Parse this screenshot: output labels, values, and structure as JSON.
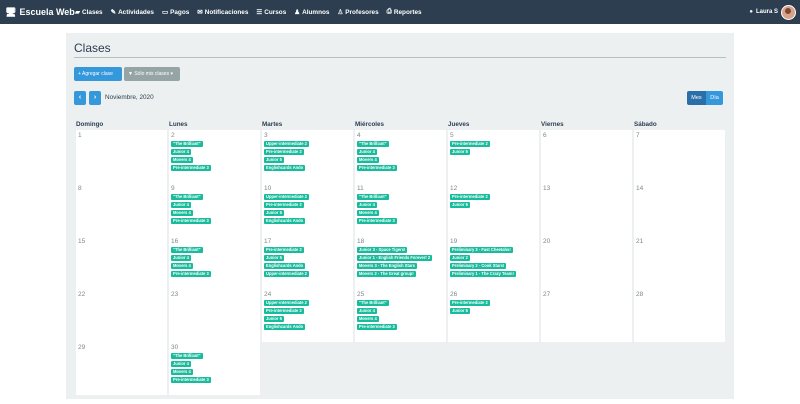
{
  "navbar": {
    "brand": "Escuela Web",
    "brand_icon": "monitor-icon",
    "items": [
      {
        "label": "Clases",
        "icon": "book-icon"
      },
      {
        "label": "Actividades",
        "icon": "pencil-icon"
      },
      {
        "label": "Pagos",
        "icon": "credit-card-icon"
      },
      {
        "label": "Notificaciones",
        "icon": "envelope-icon"
      },
      {
        "label": "Cursos",
        "icon": "list-icon"
      },
      {
        "label": "Alumnos",
        "icon": "student-icon"
      },
      {
        "label": "Profesores",
        "icon": "teacher-icon"
      },
      {
        "label": "Reportes",
        "icon": "print-icon"
      }
    ],
    "user": "Laura S"
  },
  "page": {
    "title": "Clases",
    "add_button": "+ Agregar clase",
    "filter_button": "Sólo mis clases",
    "prev": "‹",
    "next": "›",
    "month": "Noviembre, 2020",
    "view_month": "Mes",
    "view_day": "Día"
  },
  "calendar": {
    "weekdays": [
      "Domingo",
      "Lunes",
      "Martes",
      "Miércoles",
      "Jueves",
      "Viernes",
      "Sábado"
    ],
    "weeks": [
      [
        {
          "day": "1",
          "events": []
        },
        {
          "day": "2",
          "events": [
            "\"The Brilliant\"",
            "Junior 4",
            "Movers 4",
            "Pre-intermediate 3"
          ]
        },
        {
          "day": "3",
          "events": [
            "Upper-intermediate 2",
            "Pre-intermediate 2",
            "Junior 5",
            "Englishcards Ando"
          ]
        },
        {
          "day": "4",
          "events": [
            "\"The Brilliant\"",
            "Junior 4",
            "Movers 4",
            "Pre-intermediate 3"
          ]
        },
        {
          "day": "5",
          "events": [
            "Pre-intermediate 2",
            "Junior 5"
          ]
        },
        {
          "day": "6",
          "events": []
        },
        {
          "day": "7",
          "events": []
        }
      ],
      [
        {
          "day": "8",
          "events": []
        },
        {
          "day": "9",
          "events": [
            "\"The Brilliant\"",
            "Junior 4",
            "Movers 4",
            "Pre-intermediate 3"
          ]
        },
        {
          "day": "10",
          "events": [
            "Upper-intermediate 2",
            "Pre-intermediate 2",
            "Junior 5",
            "Englishcards Ando"
          ]
        },
        {
          "day": "11",
          "events": [
            "\"The Brilliant\"",
            "Junior 4",
            "Movers 4",
            "Pre-intermediate 3"
          ]
        },
        {
          "day": "12",
          "events": [
            "Pre-intermediate 2",
            "Junior 5"
          ]
        },
        {
          "day": "13",
          "events": []
        },
        {
          "day": "14",
          "events": []
        }
      ],
      [
        {
          "day": "15",
          "events": []
        },
        {
          "day": "16",
          "events": [
            "\"The Brilliant\"",
            "Junior 4",
            "Movers 4",
            "Pre-intermediate 3"
          ]
        },
        {
          "day": "17",
          "events": [
            "Pre-intermediate 2",
            "Junior 5",
            "Englishcards Ando",
            "Upper-intermediate 2"
          ]
        },
        {
          "day": "18",
          "events": [
            "Junior 3 - Space Tigers!",
            "Junior 1 - English Friends Forever! 2",
            "Movers 3 - The English Stars",
            "Movers 2 - The Great group!"
          ]
        },
        {
          "day": "19",
          "events": [
            "Preliminary 3 - Fast Cheetahs!",
            "Junior 2",
            "Preliminary 2 - Cook Stars!",
            "Preliminary 1 - The Crazy Team!"
          ]
        },
        {
          "day": "20",
          "events": []
        },
        {
          "day": "21",
          "events": []
        }
      ],
      [
        {
          "day": "22",
          "events": []
        },
        {
          "day": "23",
          "events": []
        },
        {
          "day": "24",
          "events": [
            "Upper-intermediate 2",
            "Pre-intermediate 2",
            "Junior 5",
            "Englishcards Ando"
          ]
        },
        {
          "day": "25",
          "events": [
            "\"The Brilliant\"",
            "Junior 4",
            "Movers 4",
            "Pre-intermediate 3"
          ]
        },
        {
          "day": "26",
          "events": [
            "Pre-intermediate 2",
            "Junior 5"
          ]
        },
        {
          "day": "27",
          "events": []
        },
        {
          "day": "28",
          "events": []
        }
      ],
      [
        {
          "day": "29",
          "events": []
        },
        {
          "day": "30",
          "events": [
            "\"The Brilliant\"",
            "Junior 4",
            "Movers 4",
            "Pre-intermediate 3"
          ]
        }
      ]
    ]
  }
}
